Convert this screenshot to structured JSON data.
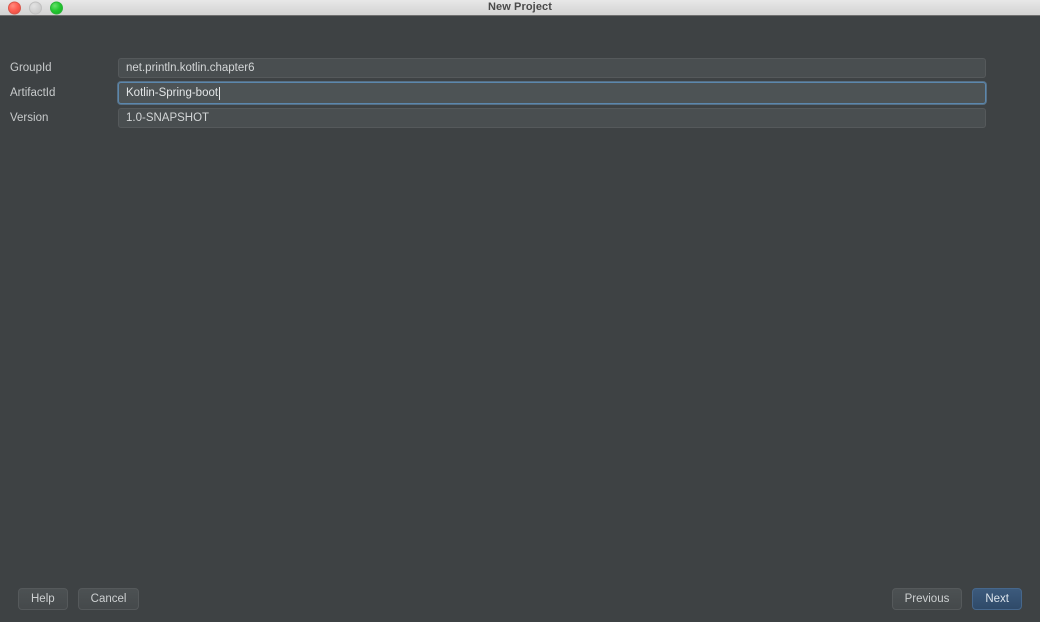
{
  "window": {
    "title": "New Project",
    "traffic_lights": [
      {
        "name": "close",
        "color": "#ff6054"
      },
      {
        "name": "minimize",
        "color": "#d2d2d2"
      },
      {
        "name": "maximize",
        "color": "#23c831"
      }
    ],
    "background_color": "#3e4244",
    "accent_color": "#3c5a7c",
    "focus_border_color": "#5b87ad"
  },
  "form": {
    "fields": [
      {
        "label": "GroupId",
        "value": "net.println.kotlin.chapter6",
        "focused": false
      },
      {
        "label": "ArtifactId",
        "value": "Kotlin-Spring-boot",
        "focused": true
      },
      {
        "label": "Version",
        "value": "1.0-SNAPSHOT",
        "focused": false
      }
    ]
  },
  "footer": {
    "help_label": "Help",
    "cancel_label": "Cancel",
    "previous_label": "Previous",
    "next_label": "Next"
  }
}
